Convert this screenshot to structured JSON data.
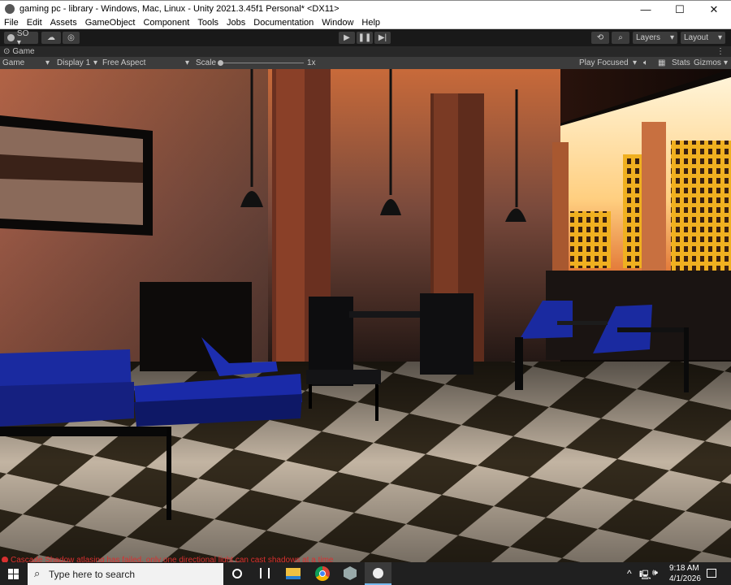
{
  "window": {
    "title": "gaming pc - library - Windows, Mac, Linux - Unity 2021.3.45f1 Personal* <DX11>",
    "minimize": "—",
    "maximize": "☐",
    "close": "✕"
  },
  "menu": [
    "File",
    "Edit",
    "Assets",
    "GameObject",
    "Component",
    "Tools",
    "Jobs",
    "Documentation",
    "Window",
    "Help"
  ],
  "toolbar": {
    "account": "SO ▾",
    "layers": "Layers",
    "layout": "Layout"
  },
  "game_tab": {
    "label": "Game"
  },
  "game_toolbar": {
    "mode": "Game",
    "display": "Display 1",
    "aspect": "Free Aspect",
    "scale_label": "Scale",
    "scale_value": "1x",
    "scale_fraction": 0,
    "play_focused": "Play Focused",
    "stats": "Stats",
    "gizmos": "Gizmos"
  },
  "status": {
    "message": "Cascade Shadow atlasing has failed, only one directional light can cast shadows at a time",
    "color": "#d83030"
  },
  "taskbar": {
    "search_placeholder": "Type here to search",
    "time": "9:18 AM",
    "date": "4/1/2026"
  },
  "icons": [
    "unity-icon",
    "account-icon",
    "cloud-icon",
    "collab-icon",
    "play-icon",
    "pause-icon",
    "step-icon",
    "history-icon",
    "search-icon",
    "windows-start-icon",
    "cortana-icon",
    "task-view-icon",
    "file-explorer-icon",
    "chrome-icon",
    "unity-hub-icon",
    "unity-editor-icon",
    "tray-chevron-icon",
    "network-icon",
    "volume-icon",
    "notification-icon"
  ]
}
